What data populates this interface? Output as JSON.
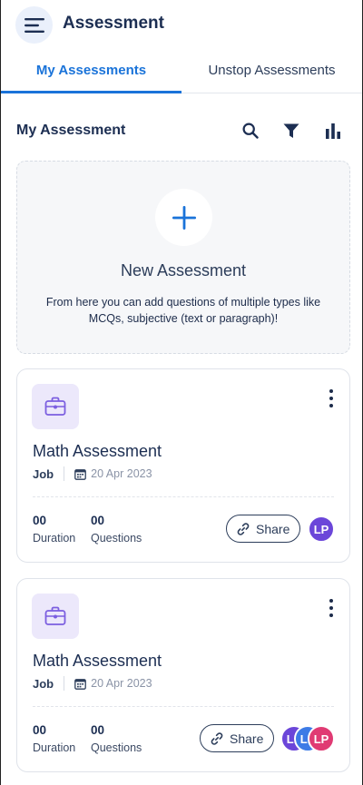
{
  "header": {
    "title": "Assessment",
    "menu_icon": "hamburger-menu-icon"
  },
  "tabs": [
    {
      "label": "My Assessments",
      "active": true
    },
    {
      "label": "Unstop Assessments",
      "active": false
    }
  ],
  "section": {
    "title": "My Assessment",
    "icons": [
      "search-icon",
      "filter-icon",
      "bar-chart-icon"
    ]
  },
  "new_assessment": {
    "title": "New Assessment",
    "description": "From here you can add questions of multiple types like MCQs, subjective (text or paragraph)!"
  },
  "assessments": [
    {
      "title": "Math Assessment",
      "type": "Job",
      "date": "20 Apr 2023",
      "duration_value": "00",
      "duration_label": "Duration",
      "questions_value": "00",
      "questions_label": "Questions",
      "share_label": "Share",
      "avatars": [
        {
          "initials": "LP",
          "color": "#6b46d9"
        }
      ]
    },
    {
      "title": "Math Assessment",
      "type": "Job",
      "date": "20 Apr 2023",
      "duration_value": "00",
      "duration_label": "Duration",
      "questions_value": "00",
      "questions_label": "Questions",
      "share_label": "Share",
      "avatars": [
        {
          "initials": "LP",
          "color": "#6b46d9"
        },
        {
          "initials": "LP",
          "color": "#3d7be6"
        },
        {
          "initials": "LP",
          "color": "#e03a73"
        }
      ]
    }
  ],
  "colors": {
    "accent": "#1a73d9",
    "briefcase_bg": "#ece8fb",
    "briefcase_icon": "#7b5ee0"
  }
}
